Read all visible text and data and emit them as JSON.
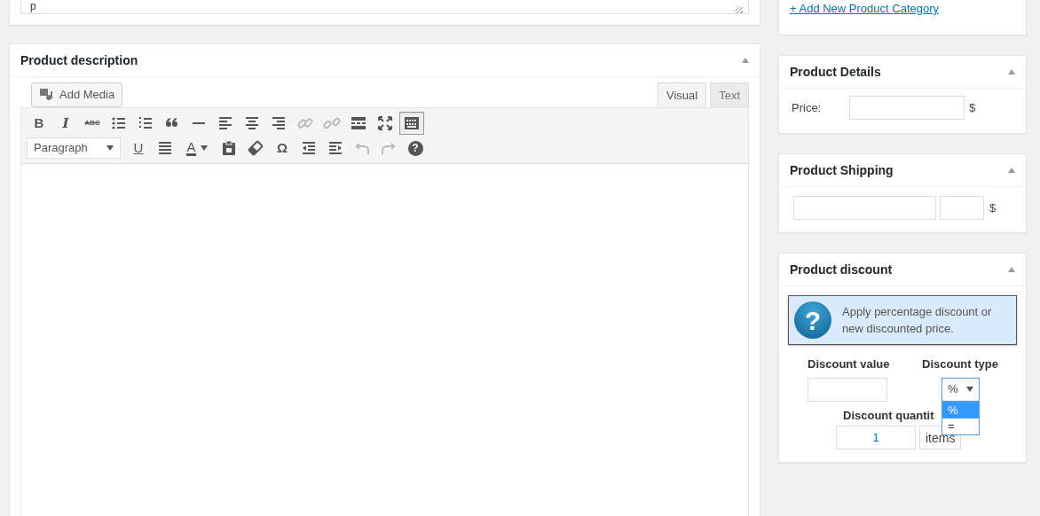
{
  "top_editor": {
    "path": "p"
  },
  "description": {
    "title": "Product description",
    "add_media": "Add Media",
    "tabs": [
      {
        "label": "Visual",
        "selected": true
      },
      {
        "label": "Text",
        "selected": false
      }
    ],
    "toolbar_rows": [
      [
        {
          "kind": "bold",
          "label": "B",
          "disabled": false,
          "active": false
        },
        {
          "kind": "italic",
          "label": "I",
          "disabled": false,
          "active": false
        },
        {
          "kind": "strike",
          "label": "ABC",
          "disabled": false,
          "active": false
        },
        {
          "kind": "bullets",
          "disabled": false,
          "active": false
        },
        {
          "kind": "numbers",
          "disabled": false,
          "active": false
        },
        {
          "kind": "quote",
          "disabled": false,
          "active": false
        },
        {
          "kind": "rule",
          "disabled": false,
          "active": false
        },
        {
          "kind": "align-left",
          "disabled": false,
          "active": false
        },
        {
          "kind": "align-center",
          "disabled": false,
          "active": false
        },
        {
          "kind": "align-right",
          "disabled": false,
          "active": false
        },
        {
          "kind": "link",
          "disabled": true,
          "active": false
        },
        {
          "kind": "unlink",
          "disabled": true,
          "active": false
        },
        {
          "kind": "more",
          "disabled": false,
          "active": false
        },
        {
          "kind": "fullscreen",
          "disabled": false,
          "active": false
        },
        {
          "kind": "kitchen-sink",
          "disabled": false,
          "active": true
        }
      ],
      [
        {
          "kind": "format",
          "label": "Paragraph"
        },
        {
          "kind": "underline",
          "label": "U",
          "disabled": false,
          "active": false
        },
        {
          "kind": "justify",
          "disabled": false,
          "active": false
        },
        {
          "kind": "text-color",
          "label": "A",
          "disabled": false,
          "active": false
        },
        {
          "kind": "paste",
          "disabled": false,
          "active": false
        },
        {
          "kind": "eraser",
          "disabled": false,
          "active": false
        },
        {
          "kind": "omega",
          "label": "Ω",
          "disabled": false,
          "active": false
        },
        {
          "kind": "outdent",
          "disabled": false,
          "active": false
        },
        {
          "kind": "indent",
          "disabled": false,
          "active": false
        },
        {
          "kind": "undo",
          "disabled": true,
          "active": false
        },
        {
          "kind": "redo",
          "disabled": true,
          "active": false
        },
        {
          "kind": "help",
          "label": "?",
          "disabled": false,
          "active": false
        }
      ]
    ]
  },
  "category": {
    "add_link": "+ Add New Product Category"
  },
  "details": {
    "title": "Product Details",
    "price_label": "Price:",
    "currency": "$"
  },
  "shipping": {
    "title": "Product Shipping",
    "currency": "$"
  },
  "discount": {
    "title": "Product discount",
    "info_glyph": "?",
    "info_text": "Apply percentage discount or new discounted price.",
    "value_label": "Discount value",
    "type_label": "Discount type",
    "type_value": "%",
    "type_options": [
      {
        "label": "%",
        "selected": true
      },
      {
        "label": "=",
        "selected": false
      }
    ],
    "quantity_label": "Discount quantit",
    "quantity_value": "1",
    "quantity_unit": "items"
  }
}
